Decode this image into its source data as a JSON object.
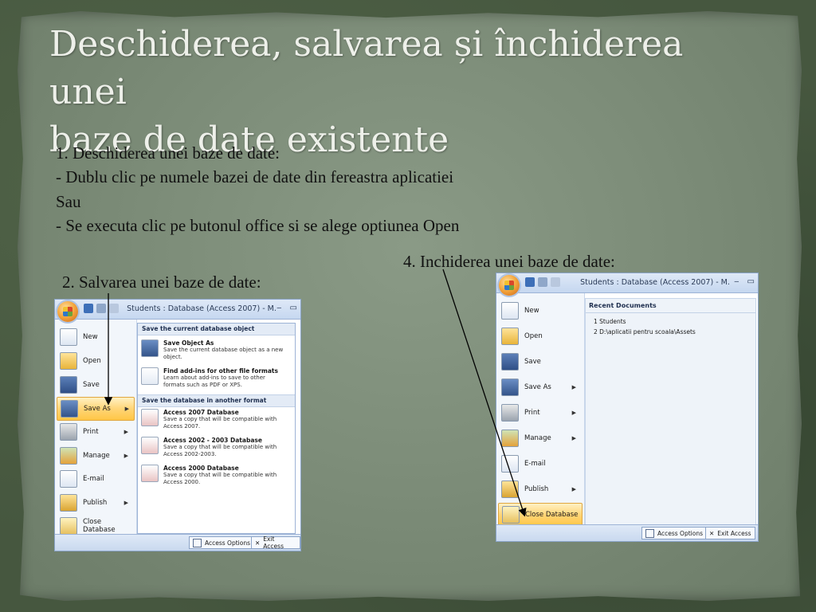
{
  "slide": {
    "title_line1": "Deschiderea, salvarea și închiderea unei",
    "title_line2": "baze de date existente",
    "items": {
      "p1": "1.    Deschiderea unei baze de date:",
      "p2": "-     Dublu clic pe numele bazei de date din fereastra  aplicatiei",
      "p3": "Sau",
      "p4": "-  Se executa clic pe butonul office si se alege optiunea Open",
      "p5": "2. Salvarea unei  baze de date:",
      "p6": "4. Inchiderea unei baze de date:"
    }
  },
  "window_save": {
    "title": "Students : Database (Access 2007) - M.",
    "menu": [
      {
        "label": "New",
        "icon": "new-document-icon"
      },
      {
        "label": "Open",
        "icon": "open-folder-icon"
      },
      {
        "label": "Save",
        "icon": "save-disk-icon"
      },
      {
        "label": "Save As",
        "icon": "save-as-icon",
        "selected": true,
        "arrow": true
      },
      {
        "label": "Print",
        "icon": "printer-icon",
        "arrow": true
      },
      {
        "label": "Manage",
        "icon": "manage-icon",
        "arrow": true
      },
      {
        "label": "E-mail",
        "icon": "email-icon"
      },
      {
        "label": "Publish",
        "icon": "publish-icon",
        "arrow": true
      },
      {
        "label": "Close Database",
        "icon": "close-database-icon"
      }
    ],
    "submenu": {
      "header1": "Save the current database object",
      "header2": "Save the database in another format",
      "items": [
        {
          "title": "Save Object As",
          "desc1": "Save the current database object as a new",
          "desc2": "object."
        },
        {
          "title": "Find add-ins for other file formats",
          "desc1": "Learn about add-ins to save to other",
          "desc2": "formats such as PDF or XPS."
        },
        {
          "title": "Access 2007 Database",
          "desc1": "Save a copy that will be compatible with",
          "desc2": "Access 2007."
        },
        {
          "title": "Access 2002 - 2003 Database",
          "desc1": "Save a copy that will be compatible with",
          "desc2": "Access 2002-2003."
        },
        {
          "title": "Access 2000 Database",
          "desc1": "Save a copy that will be compatible with",
          "desc2": "Access 2000."
        }
      ]
    },
    "footer": {
      "options": "Access Options",
      "exit": "Exit Access"
    }
  },
  "window_close": {
    "title": "Students : Database (Access 2007) - M.",
    "menu": [
      {
        "label": "New",
        "icon": "new-document-icon"
      },
      {
        "label": "Open",
        "icon": "open-folder-icon"
      },
      {
        "label": "Save",
        "icon": "save-disk-icon"
      },
      {
        "label": "Save As",
        "icon": "save-as-icon",
        "arrow": true
      },
      {
        "label": "Print",
        "icon": "printer-icon",
        "arrow": true
      },
      {
        "label": "Manage",
        "icon": "manage-icon",
        "arrow": true
      },
      {
        "label": "E-mail",
        "icon": "email-icon"
      },
      {
        "label": "Publish",
        "icon": "publish-icon",
        "arrow": true
      },
      {
        "label": "Close Database",
        "icon": "close-database-icon",
        "selected": true
      }
    ],
    "recent": {
      "header": "Recent Documents",
      "items": [
        "1 Students",
        "2 D:\\aplicatii pentru scoala\\Assets"
      ]
    },
    "footer": {
      "options": "Access Options",
      "exit": "Exit Access"
    }
  },
  "colors": {
    "title_text": "#eef0ea",
    "menu_selected": "#ffd577",
    "window_chrome": "#c5d7f0"
  }
}
